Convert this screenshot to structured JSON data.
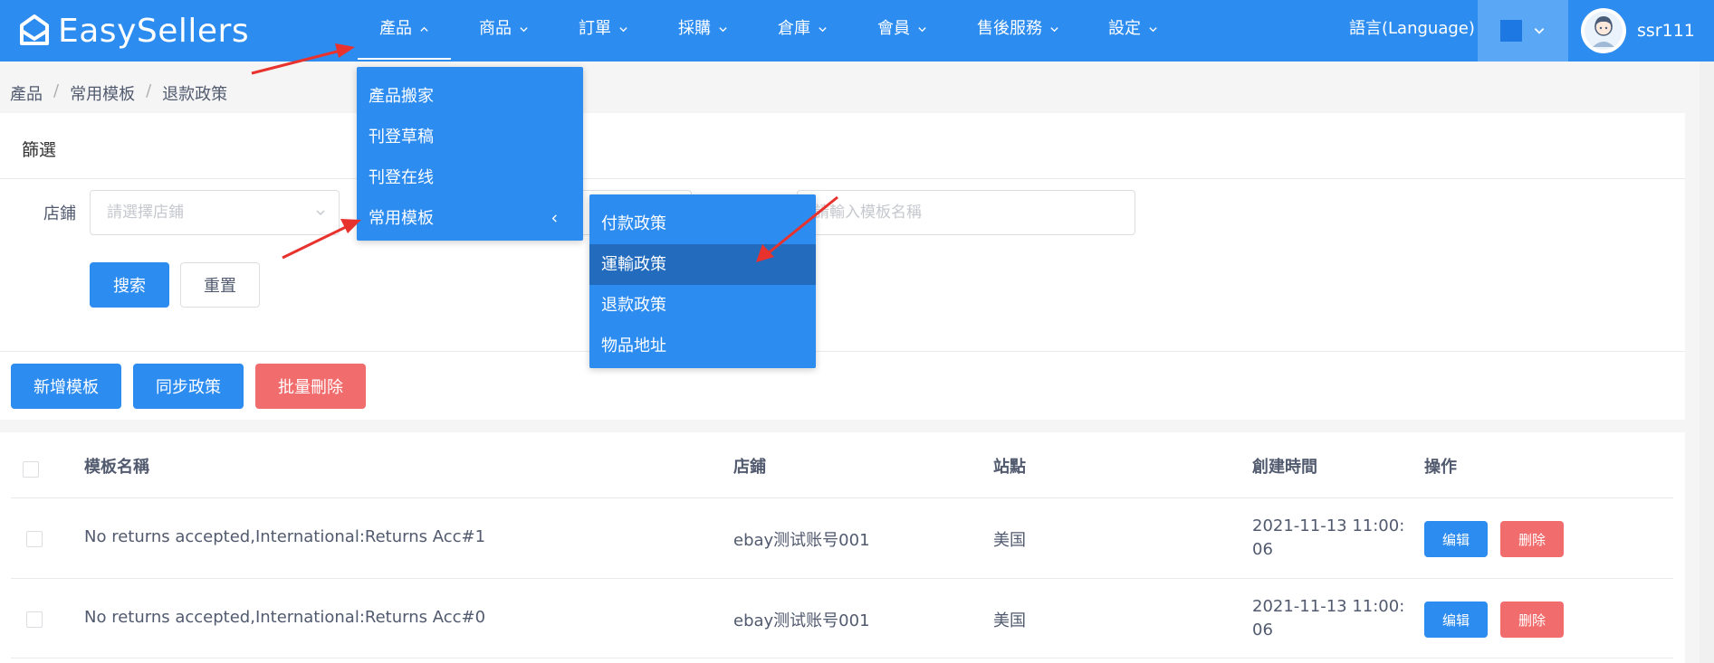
{
  "brand": {
    "name": "EasySellers"
  },
  "nav": {
    "items": [
      {
        "label": "產品",
        "open": true
      },
      {
        "label": "商品"
      },
      {
        "label": "訂單"
      },
      {
        "label": "採購"
      },
      {
        "label": "倉庫"
      },
      {
        "label": "會員"
      },
      {
        "label": "售後服務"
      },
      {
        "label": "設定"
      }
    ],
    "language": "語言(Language)",
    "username": "ssr111"
  },
  "breadcrumb": [
    "產品",
    "常用模板",
    "退款政策"
  ],
  "filter": {
    "title": "篩選",
    "shop_label": "店鋪",
    "shop_placeholder": "請選擇店鋪",
    "name_placeholder": "請輸入模板名稱",
    "search_label": "搜索",
    "reset_label": "重置"
  },
  "actions": {
    "add_label": "新增模板",
    "sync_label": "同步政策",
    "batch_delete_label": "批量刪除"
  },
  "table": {
    "columns": [
      "模板名稱",
      "店鋪",
      "站點",
      "創建時間",
      "操作"
    ],
    "rows": [
      {
        "name": "No returns accepted,International:Returns Acc#1",
        "shop": "ebay测试账号001",
        "site": "美国",
        "created": "2021-11-13 11:00:06"
      },
      {
        "name": "No returns accepted,International:Returns Acc#0",
        "shop": "ebay测试账号001",
        "site": "美国",
        "created": "2021-11-13 11:00:06"
      }
    ],
    "edit_label": "编辑",
    "delete_label": "删除"
  },
  "product_menu": {
    "items": [
      "產品搬家",
      "刊登草稿",
      "刊登在线",
      "常用模板"
    ]
  },
  "template_submenu": {
    "items": [
      "付款政策",
      "運輸政策",
      "退款政策",
      "物品地址"
    ],
    "hovered": "運輸政策"
  },
  "colors": {
    "primary": "#2d8cf0",
    "danger": "#f16d6d",
    "menu_hover": "#226bbd",
    "annotation_arrow": "#e8322d"
  },
  "icons": [
    "envelope-logo-icon",
    "chevron-up-icon",
    "chevron-down-icon",
    "chevron-left-icon",
    "avatar-icon",
    "checkbox-icon",
    "annotation-arrow"
  ]
}
